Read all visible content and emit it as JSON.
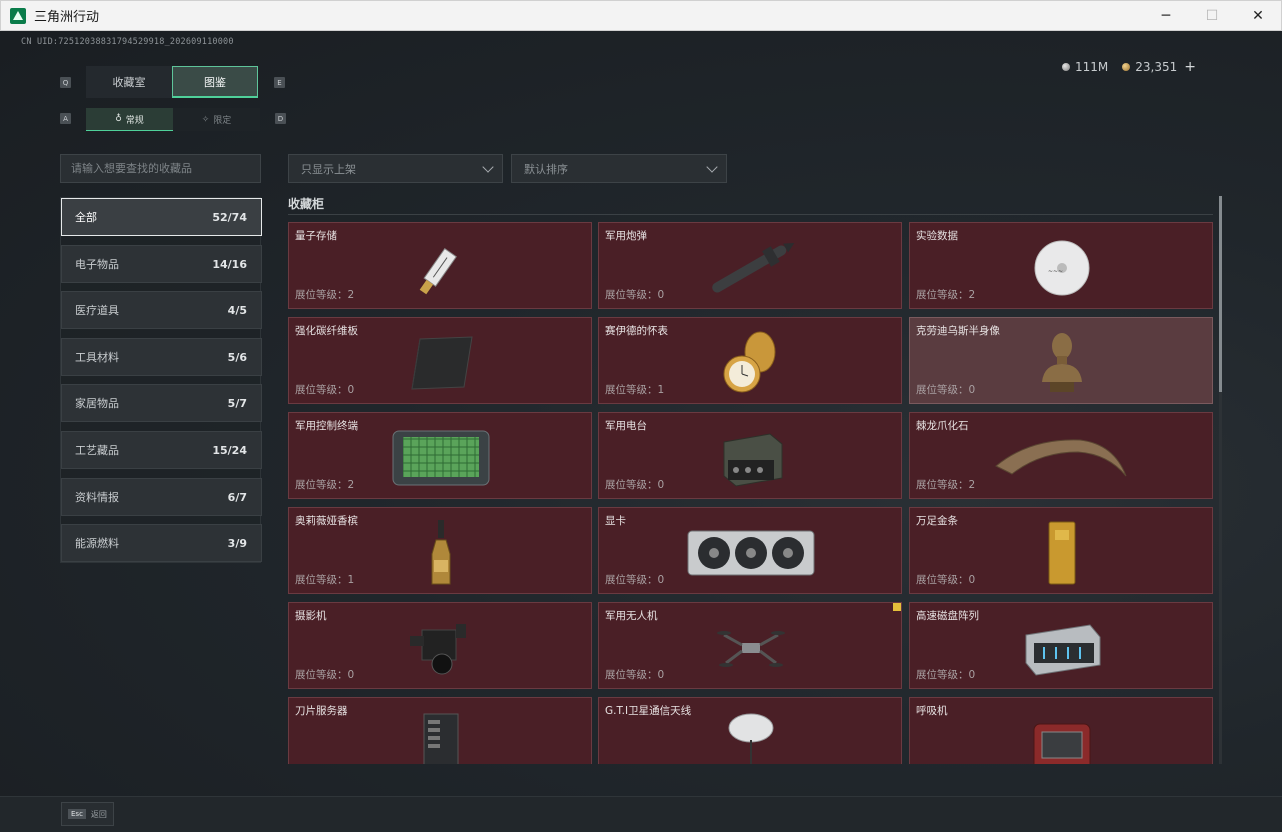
{
  "window": {
    "title": "三角洲行动",
    "controls": {
      "minimize": "─",
      "maximize": "☐",
      "close": "✕"
    }
  },
  "uid": "CN UID:7251203883179452991​8_202609110000",
  "currency": {
    "silver": "111M",
    "gold": "23,351",
    "add": "+"
  },
  "tabs": {
    "main": [
      {
        "label": "收藏室"
      },
      {
        "label": "图鉴"
      }
    ],
    "sub": [
      {
        "label": "常规"
      },
      {
        "label": "限定"
      }
    ],
    "keys": {
      "left1": "Q",
      "right1": "E",
      "left2": "A",
      "right2": "D"
    }
  },
  "search": {
    "placeholder": "请输入想要查找的收藏品"
  },
  "filters": {
    "shelf": "只显示上架",
    "sort": "默认排序"
  },
  "categories": [
    {
      "label": "全部",
      "count": "52/74"
    },
    {
      "label": "电子物品",
      "count": "14/16"
    },
    {
      "label": "医疗道具",
      "count": "4/5"
    },
    {
      "label": "工具材料",
      "count": "5/6"
    },
    {
      "label": "家居物品",
      "count": "5/7"
    },
    {
      "label": "工艺藏品",
      "count": "15/24"
    },
    {
      "label": "资料情报",
      "count": "6/7"
    },
    {
      "label": "能源燃料",
      "count": "3/9"
    }
  ],
  "cabinet": {
    "title": "收藏柜",
    "items": [
      {
        "name": "量子存储",
        "level": "展位等级：2",
        "icon": "usb-drive-icon"
      },
      {
        "name": "军用炮弹",
        "level": "展位等级：0",
        "icon": "missile-icon"
      },
      {
        "name": "实验数据",
        "level": "展位等级：2",
        "icon": "disc-icon"
      },
      {
        "name": "强化碳纤维板",
        "level": "展位等级：0",
        "icon": "carbon-plate-icon"
      },
      {
        "name": "赛伊德的怀表",
        "level": "展位等级：1",
        "icon": "pocket-watch-icon"
      },
      {
        "name": "克劳迪乌斯半身像",
        "level": "展位等级：0",
        "icon": "bust-icon"
      },
      {
        "name": "军用控制终端",
        "level": "展位等级：2",
        "icon": "terminal-icon"
      },
      {
        "name": "军用电台",
        "level": "展位等级：0",
        "icon": "radio-icon"
      },
      {
        "name": "棘龙爪化石",
        "level": "展位等级：2",
        "icon": "claw-fossil-icon"
      },
      {
        "name": "奥莉薇娅香槟",
        "level": "展位等级：1",
        "icon": "champagne-icon"
      },
      {
        "name": "显卡",
        "level": "展位等级：0",
        "icon": "gpu-icon"
      },
      {
        "name": "万足金条",
        "level": "展位等级：0",
        "icon": "gold-bar-icon"
      },
      {
        "name": "摄影机",
        "level": "展位等级：0",
        "icon": "camera-icon"
      },
      {
        "name": "军用无人机",
        "level": "展位等级：0",
        "icon": "drone-icon"
      },
      {
        "name": "高速磁盘阵列",
        "level": "展位等级：0",
        "icon": "disk-array-icon"
      },
      {
        "name": "刀片服务器",
        "level": "",
        "icon": "server-icon"
      },
      {
        "name": "G.T.I卫星通信天线",
        "level": "",
        "icon": "satellite-dish-icon"
      },
      {
        "name": "呼吸机",
        "level": "",
        "icon": "ventilator-icon"
      }
    ]
  },
  "bottom": {
    "esc_key": "Esc",
    "esc_label": "返回"
  },
  "colors": {
    "accent": "#4fd19a",
    "card_bg": "#4a1f26",
    "card_highlight": "#5a3c40"
  }
}
